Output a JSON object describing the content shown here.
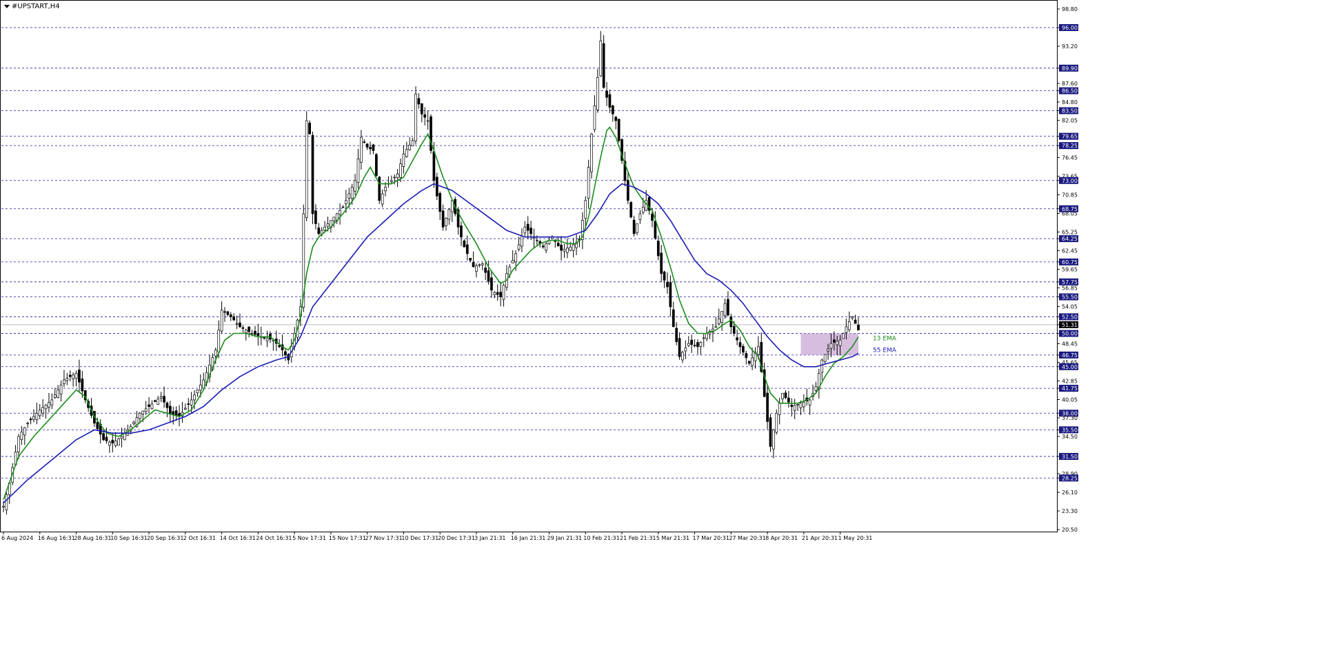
{
  "chart_data": {
    "type": "candlestick",
    "title": "#UPSTART,H4",
    "ylim": [
      20.5,
      99.5
    ],
    "y_ticks": [
      "98.80",
      "96.00",
      "93.20",
      "89.90",
      "87.60",
      "86.50",
      "84.80",
      "83.50",
      "82.05",
      "79.65",
      "78.25",
      "76.45",
      "73.65",
      "73.00",
      "70.85",
      "68.75",
      "68.05",
      "65.25",
      "64.25",
      "62.45",
      "60.75",
      "59.65",
      "57.75",
      "56.85",
      "55.50",
      "54.05",
      "52.50",
      "51.31",
      "50.00",
      "48.45",
      "46.75",
      "45.65",
      "45.00",
      "42.85",
      "41.75",
      "40.05",
      "38.00",
      "37.30",
      "35.50",
      "34.50",
      "31.50",
      "28.90",
      "28.25",
      "26.10",
      "23.30",
      "20.50"
    ],
    "y_tick_values": [
      98.8,
      96,
      93.2,
      89.9,
      87.6,
      86.5,
      84.8,
      83.5,
      82.05,
      79.65,
      78.25,
      76.45,
      73.65,
      73,
      70.85,
      68.75,
      68.05,
      65.25,
      64.25,
      62.45,
      60.75,
      59.65,
      57.75,
      56.85,
      55.5,
      54.05,
      52.5,
      51.31,
      50,
      48.45,
      46.75,
      45.65,
      45,
      42.85,
      41.75,
      40.05,
      38,
      37.3,
      35.5,
      34.5,
      31.5,
      28.9,
      28.25,
      26.1,
      23.3,
      20.5
    ],
    "x_ticks": [
      "6 Aug 2024",
      "16 Aug 16:31",
      "28 Aug 16:31",
      "10 Sep 16:31",
      "20 Sep 16:31",
      "2 Oct 16:31",
      "14 Oct 16:31",
      "24 Oct 16:31",
      "5 Nov 17:31",
      "15 Nov 17:31",
      "27 Nov 17:31",
      "10 Dec 17:31",
      "20 Dec 17:31",
      "3 Jan 21:31",
      "16 Jan 21:31",
      "29 Jan 21:31",
      "10 Feb 21:31",
      "21 Feb 21:31",
      "5 Mar 21:31",
      "17 Mar 20:31",
      "27 Mar 20:31",
      "8 Apr 20:31",
      "21 Apr 20:31",
      "1 May 20:31"
    ],
    "x_tick_index": [
      0,
      12,
      24,
      36,
      48,
      60,
      72,
      84,
      96,
      108,
      120,
      132,
      144,
      156,
      168,
      180,
      192,
      204,
      216,
      228,
      240,
      252,
      264,
      276
    ],
    "bar_count": 283,
    "horizontal_levels": [
      96.0,
      89.9,
      86.5,
      83.5,
      79.65,
      78.25,
      73.0,
      68.75,
      64.25,
      60.75,
      57.75,
      55.5,
      52.5,
      50.0,
      46.75,
      45.0,
      41.75,
      38.0,
      35.5,
      31.5,
      28.25
    ],
    "current_price": 51.31,
    "price_path": [
      [
        0,
        24.0
      ],
      [
        2,
        27.5
      ],
      [
        5,
        34.5
      ],
      [
        8,
        36.5
      ],
      [
        12,
        38.5
      ],
      [
        16,
        40.0
      ],
      [
        20,
        43.0
      ],
      [
        24,
        44.0
      ],
      [
        27,
        40.0
      ],
      [
        30,
        36.5
      ],
      [
        33,
        34.0
      ],
      [
        36,
        33.5
      ],
      [
        39,
        34.5
      ],
      [
        42,
        36.0
      ],
      [
        45,
        38.0
      ],
      [
        48,
        39.0
      ],
      [
        52,
        40.5
      ],
      [
        55,
        38.0
      ],
      [
        58,
        37.5
      ],
      [
        62,
        40.0
      ],
      [
        66,
        43.0
      ],
      [
        70,
        47.5
      ],
      [
        72,
        53.5
      ],
      [
        75,
        52.5
      ],
      [
        78,
        51.0
      ],
      [
        82,
        50.0
      ],
      [
        85,
        49.5
      ],
      [
        89,
        49.0
      ],
      [
        92,
        47.5
      ],
      [
        94,
        46.0
      ],
      [
        96,
        50.0
      ],
      [
        98,
        54.0
      ],
      [
        100,
        82.0
      ],
      [
        101,
        80.0
      ],
      [
        102,
        68.0
      ],
      [
        104,
        65.0
      ],
      [
        108,
        67.0
      ],
      [
        112,
        69.0
      ],
      [
        116,
        73.0
      ],
      [
        118,
        79.5
      ],
      [
        120,
        78.0
      ],
      [
        122,
        77.5
      ],
      [
        124,
        70.0
      ],
      [
        126,
        72.0
      ],
      [
        130,
        74.0
      ],
      [
        132,
        77.0
      ],
      [
        135,
        79.0
      ],
      [
        136,
        86.0
      ],
      [
        138,
        83.0
      ],
      [
        140,
        82.0
      ],
      [
        142,
        73.0
      ],
      [
        145,
        66.0
      ],
      [
        148,
        70.0
      ],
      [
        150,
        66.0
      ],
      [
        152,
        63.0
      ],
      [
        155,
        60.0
      ],
      [
        158,
        60.5
      ],
      [
        161,
        56.5
      ],
      [
        164,
        55.5
      ],
      [
        166,
        59.0
      ],
      [
        169,
        62.0
      ],
      [
        172,
        66.0
      ],
      [
        175,
        64.5
      ],
      [
        178,
        63.0
      ],
      [
        181,
        64.5
      ],
      [
        184,
        62.5
      ],
      [
        187,
        63.0
      ],
      [
        190,
        64.0
      ],
      [
        192,
        70.0
      ],
      [
        194,
        80.0
      ],
      [
        196,
        88.5
      ],
      [
        197,
        94.0
      ],
      [
        198,
        87.0
      ],
      [
        200,
        84.0
      ],
      [
        202,
        82.0
      ],
      [
        204,
        76.0
      ],
      [
        206,
        70.0
      ],
      [
        208,
        65.0
      ],
      [
        210,
        68.0
      ],
      [
        212,
        70.0
      ],
      [
        214,
        67.0
      ],
      [
        217,
        59.0
      ],
      [
        219,
        57.0
      ],
      [
        221,
        51.0
      ],
      [
        223,
        46.5
      ],
      [
        226,
        48.5
      ],
      [
        229,
        48.0
      ],
      [
        232,
        50.0
      ],
      [
        235,
        51.0
      ],
      [
        238,
        54.5
      ],
      [
        240,
        51.0
      ],
      [
        243,
        48.0
      ],
      [
        246,
        45.5
      ],
      [
        249,
        48.0
      ],
      [
        251,
        40.5
      ],
      [
        253,
        33.0
      ],
      [
        255,
        38.0
      ],
      [
        257,
        41.0
      ],
      [
        260,
        39.0
      ],
      [
        263,
        39.5
      ],
      [
        266,
        40.0
      ],
      [
        268,
        42.0
      ],
      [
        270,
        46.0
      ],
      [
        273,
        48.5
      ],
      [
        276,
        49.0
      ],
      [
        278,
        51.0
      ],
      [
        280,
        52.5
      ],
      [
        282,
        50.5
      ]
    ],
    "series": [
      {
        "name": "13 EMA",
        "color": "#1a8c1a",
        "points": [
          [
            0,
            25.0
          ],
          [
            5,
            31.5
          ],
          [
            10,
            34.5
          ],
          [
            15,
            37.0
          ],
          [
            20,
            39.5
          ],
          [
            24,
            41.5
          ],
          [
            27,
            40.5
          ],
          [
            30,
            37.5
          ],
          [
            34,
            35.0
          ],
          [
            38,
            34.5
          ],
          [
            42,
            35.5
          ],
          [
            46,
            37.0
          ],
          [
            50,
            38.5
          ],
          [
            54,
            38.0
          ],
          [
            58,
            37.5
          ],
          [
            62,
            38.5
          ],
          [
            66,
            41.5
          ],
          [
            70,
            46.0
          ],
          [
            73,
            49.0
          ],
          [
            76,
            50.0
          ],
          [
            80,
            50.0
          ],
          [
            84,
            49.5
          ],
          [
            88,
            49.5
          ],
          [
            92,
            48.0
          ],
          [
            94,
            47.5
          ],
          [
            96,
            49.0
          ],
          [
            98,
            52.5
          ],
          [
            100,
            59.0
          ],
          [
            102,
            63.0
          ],
          [
            104,
            64.5
          ],
          [
            108,
            66.0
          ],
          [
            112,
            68.0
          ],
          [
            116,
            70.5
          ],
          [
            119,
            73.5
          ],
          [
            121,
            75.0
          ],
          [
            124,
            72.5
          ],
          [
            128,
            72.5
          ],
          [
            132,
            73.5
          ],
          [
            135,
            76.0
          ],
          [
            138,
            78.5
          ],
          [
            140,
            80.0
          ],
          [
            142,
            77.5
          ],
          [
            145,
            73.5
          ],
          [
            149,
            69.0
          ],
          [
            152,
            66.5
          ],
          [
            156,
            63.5
          ],
          [
            160,
            60.0
          ],
          [
            164,
            57.5
          ],
          [
            166,
            58.0
          ],
          [
            168,
            59.5
          ],
          [
            171,
            61.0
          ],
          [
            174,
            62.5
          ],
          [
            177,
            63.5
          ],
          [
            180,
            64.0
          ],
          [
            183,
            64.0
          ],
          [
            186,
            63.5
          ],
          [
            189,
            63.5
          ],
          [
            191,
            64.5
          ],
          [
            193,
            67.5
          ],
          [
            195,
            72.0
          ],
          [
            197,
            76.5
          ],
          [
            199,
            80.5
          ],
          [
            200,
            81.0
          ],
          [
            202,
            79.5
          ],
          [
            205,
            75.5
          ],
          [
            208,
            72.0
          ],
          [
            211,
            70.0
          ],
          [
            214,
            68.5
          ],
          [
            217,
            64.5
          ],
          [
            220,
            60.0
          ],
          [
            223,
            55.0
          ],
          [
            226,
            51.5
          ],
          [
            229,
            50.0
          ],
          [
            232,
            50.0
          ],
          [
            235,
            50.5
          ],
          [
            238,
            51.5
          ],
          [
            240,
            52.0
          ],
          [
            243,
            50.5
          ],
          [
            246,
            48.0
          ],
          [
            249,
            46.5
          ],
          [
            251,
            43.5
          ],
          [
            253,
            41.0
          ],
          [
            256,
            39.5
          ],
          [
            259,
            39.5
          ],
          [
            262,
            39.5
          ],
          [
            265,
            40.0
          ],
          [
            268,
            41.0
          ],
          [
            271,
            43.5
          ],
          [
            274,
            45.5
          ],
          [
            277,
            46.5
          ],
          [
            280,
            48.0
          ],
          [
            282,
            49.5
          ]
        ]
      },
      {
        "name": "55 EMA",
        "color": "#1a1ab4",
        "points": [
          [
            0,
            24.5
          ],
          [
            8,
            28.0
          ],
          [
            16,
            31.0
          ],
          [
            24,
            34.0
          ],
          [
            30,
            35.5
          ],
          [
            36,
            35.0
          ],
          [
            42,
            35.0
          ],
          [
            48,
            35.5
          ],
          [
            54,
            36.5
          ],
          [
            60,
            37.5
          ],
          [
            66,
            39.0
          ],
          [
            72,
            41.5
          ],
          [
            78,
            43.5
          ],
          [
            84,
            45.0
          ],
          [
            90,
            46.0
          ],
          [
            94,
            46.5
          ],
          [
            98,
            49.5
          ],
          [
            102,
            54.0
          ],
          [
            108,
            57.5
          ],
          [
            114,
            61.0
          ],
          [
            120,
            64.5
          ],
          [
            126,
            67.0
          ],
          [
            132,
            69.5
          ],
          [
            138,
            71.5
          ],
          [
            142,
            72.5
          ],
          [
            148,
            71.5
          ],
          [
            154,
            69.5
          ],
          [
            160,
            67.5
          ],
          [
            166,
            65.5
          ],
          [
            172,
            64.5
          ],
          [
            180,
            64.5
          ],
          [
            186,
            64.5
          ],
          [
            192,
            65.5
          ],
          [
            196,
            68.0
          ],
          [
            200,
            71.0
          ],
          [
            204,
            72.5
          ],
          [
            208,
            72.0
          ],
          [
            212,
            71.0
          ],
          [
            216,
            69.5
          ],
          [
            220,
            67.0
          ],
          [
            224,
            64.0
          ],
          [
            228,
            61.0
          ],
          [
            232,
            59.0
          ],
          [
            236,
            58.0
          ],
          [
            240,
            56.5
          ],
          [
            244,
            54.5
          ],
          [
            248,
            52.0
          ],
          [
            252,
            49.5
          ],
          [
            256,
            47.5
          ],
          [
            260,
            46.0
          ],
          [
            264,
            45.0
          ],
          [
            268,
            45.0
          ],
          [
            272,
            45.5
          ],
          [
            276,
            46.0
          ],
          [
            280,
            46.5
          ],
          [
            282,
            47.0
          ]
        ]
      }
    ],
    "annotations": [
      {
        "text": "13 EMA",
        "color": "#1a8c1a",
        "price": 49.4
      },
      {
        "text": "55 EMA",
        "color": "#1a1ab4",
        "price": 47.6
      }
    ],
    "highlight_box": {
      "x_from": 263,
      "x_to": 282,
      "y_from": 46.75,
      "y_to": 50.0,
      "color": "#c9a8d4"
    }
  }
}
